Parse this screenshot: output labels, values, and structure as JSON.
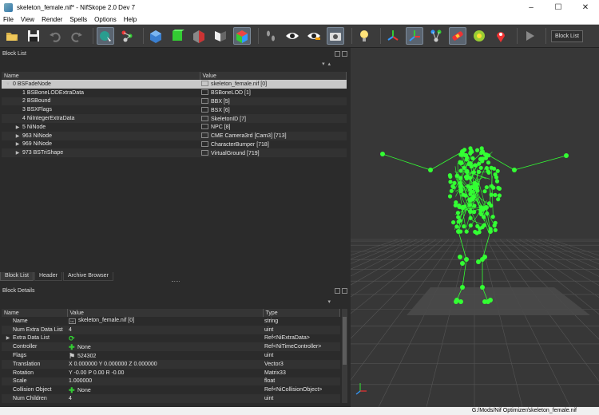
{
  "window": {
    "title": "skeleton_female.nif* - NifSkope 2.0 Dev 7",
    "minimize": "–",
    "maximize": "☐",
    "close": "✕"
  },
  "menu": [
    "File",
    "View",
    "Render",
    "Spells",
    "Options",
    "Help"
  ],
  "toolbar": {
    "icons": [
      "open-icon",
      "save-icon",
      "undo-icon",
      "redo-icon",
      "select-mode-icon",
      "transform-icon",
      "cube-blue-icon",
      "cube-green-icon",
      "cube-red-icon",
      "flip-icon",
      "cube-color-icon",
      "footprints-icon",
      "eye-icon",
      "eye-edit-icon",
      "screenshot-icon",
      "lightbulb-icon",
      "axes-icon",
      "skeleton-axes-icon",
      "nodes-icon",
      "texture-icon",
      "lighting-icon",
      "location-icon",
      "play-icon"
    ],
    "blocklist_button": "Block List"
  },
  "block_list": {
    "title": "Block List",
    "columns": [
      "Name",
      "Value"
    ],
    "rows": [
      {
        "expander": "▼",
        "indent": 0,
        "name": "0 BSFadeNode",
        "value": "skeleton_female.nif [0]",
        "selected": true
      },
      {
        "expander": "",
        "indent": 1,
        "name": "1 BSBoneLODExtraData",
        "value": "BSBoneLOD [1]"
      },
      {
        "expander": "",
        "indent": 1,
        "name": "2 BSBound",
        "value": "BBX [5]"
      },
      {
        "expander": "",
        "indent": 1,
        "name": "3 BSXFlags",
        "value": "BSX [6]"
      },
      {
        "expander": "",
        "indent": 1,
        "name": "4 NiIntegerExtraData",
        "value": "SkeletonID [7]"
      },
      {
        "expander": "▶",
        "indent": 1,
        "name": "5 NiNode",
        "value": "NPC [8]"
      },
      {
        "expander": "▶",
        "indent": 1,
        "name": "963 NiNode",
        "value": "CME Camera3rd [Cam3] [713]"
      },
      {
        "expander": "▶",
        "indent": 1,
        "name": "969 NiNode",
        "value": "CharacterBumper [718]"
      },
      {
        "expander": "▶",
        "indent": 1,
        "name": "973 BSTriShape",
        "value": "VirtualGround [719]"
      }
    ]
  },
  "tabs": [
    "Block List",
    "Header",
    "Archive Browser"
  ],
  "block_details": {
    "title": "Block Details",
    "columns": [
      "Name",
      "Value",
      "Type"
    ],
    "rows": [
      {
        "expander": "",
        "name": "Name",
        "icon": "txt",
        "value": "skeleton_female.nif [0]",
        "type": "string"
      },
      {
        "expander": "",
        "name": "Num Extra Data List",
        "icon": "",
        "value": "4",
        "type": "uint"
      },
      {
        "expander": "▶",
        "name": "Extra Data List",
        "icon": "link",
        "value": "",
        "type": "Ref<NiExtraData>"
      },
      {
        "expander": "",
        "name": "Controller",
        "icon": "plus",
        "value": "None",
        "type": "Ref<NiTimeController>"
      },
      {
        "expander": "",
        "name": "Flags",
        "icon": "flag",
        "value": "524302",
        "type": "uint"
      },
      {
        "expander": "",
        "name": "Translation",
        "icon": "",
        "value": "X 0.000000 Y 0.000000 Z 0.000000",
        "type": "Vector3"
      },
      {
        "expander": "",
        "name": "Rotation",
        "icon": "",
        "value": "Y -0.00 P 0.00 R -0.00",
        "type": "Matrix33"
      },
      {
        "expander": "",
        "name": "Scale",
        "icon": "",
        "value": "1.000000",
        "type": "float"
      },
      {
        "expander": "",
        "name": "Collision Object",
        "icon": "plus",
        "value": "None",
        "type": "Ref<NiCollisionObject>"
      },
      {
        "expander": "",
        "name": "Num Children",
        "icon": "",
        "value": "4",
        "type": "uint"
      }
    ]
  },
  "statusbar": {
    "path": "G:/Mods/Nif Optimizer/skeleton_female.nif"
  },
  "colors": {
    "bone": "#33ff33",
    "viewport_bg": "#373737",
    "grid": "#555555",
    "ground": "#4a4a4a"
  }
}
